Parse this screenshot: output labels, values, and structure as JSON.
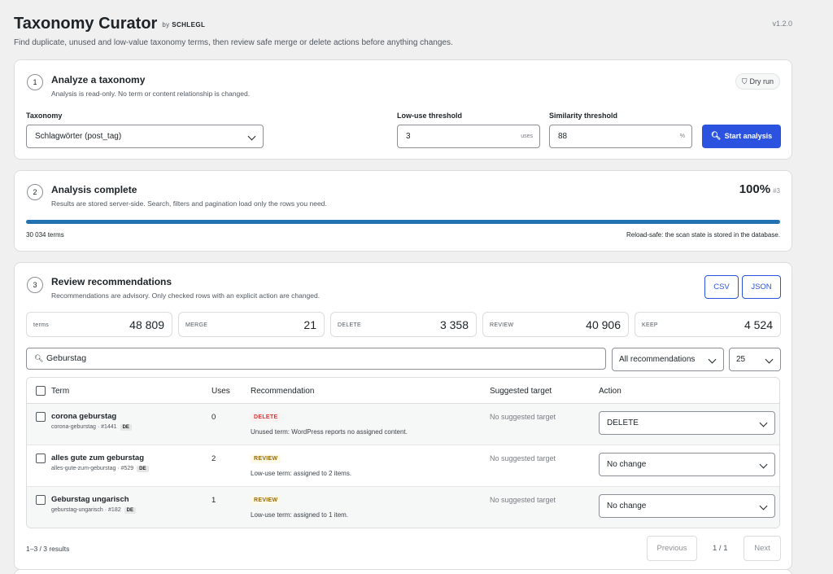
{
  "header": {
    "title": "Taxonomy Curator",
    "by_prefix": "by",
    "by_author": "SCHLEGL",
    "version": "v1.2.0",
    "subtitle": "Find duplicate, unused and low-value taxonomy terms, then review safe merge or delete actions before anything changes."
  },
  "step1": {
    "number": "1",
    "title": "Analyze a taxonomy",
    "desc": "Analysis is read-only. No term or content relationship is changed.",
    "dry_run_label": "Dry run",
    "taxonomy_label": "Taxonomy",
    "taxonomy_value": "Schlagwörter (post_tag)",
    "low_use_label": "Low-use threshold",
    "low_use_value": "3",
    "low_use_unit": "uses",
    "similarity_label": "Similarity threshold",
    "similarity_value": "88",
    "similarity_unit": "%",
    "start_label": "Start analysis"
  },
  "step2": {
    "number": "2",
    "title": "Analysis complete",
    "desc": "Results are stored server-side. Search, filters and pagination load only the rows you need.",
    "percent": "100%",
    "job": "#3",
    "progress": 1.0,
    "terms_count": "30 034 terms",
    "reload_note": "Reload-safe: the scan state is stored in the database."
  },
  "step3": {
    "number": "3",
    "title": "Review recommendations",
    "desc": "Recommendations are advisory. Only checked rows with an explicit action are changed.",
    "csv_label": "CSV",
    "json_label": "JSON",
    "stats": [
      {
        "label": "terms",
        "value": "48 809"
      },
      {
        "label": "MERGE",
        "value": "21"
      },
      {
        "label": "DELETE",
        "value": "3 358"
      },
      {
        "label": "REVIEW",
        "value": "40 906"
      },
      {
        "label": "KEEP",
        "value": "4 524"
      }
    ],
    "search_value": "Geburstag",
    "filter_value": "All recommendations",
    "per_page": "25",
    "columns": {
      "term": "Term",
      "uses": "Uses",
      "recommendation": "Recommendation",
      "target": "Suggested target",
      "action": "Action"
    },
    "rows": [
      {
        "name": "corona geburstag",
        "meta": "corona-geburstag · #1441",
        "lang": "DE",
        "uses": "0",
        "badge": "DELETE",
        "reason": "Unused term: WordPress reports no assigned content.",
        "target": "No suggested target",
        "action": "DELETE"
      },
      {
        "name": "alles gute zum geburstag",
        "meta": "alles-gute-zum-geburstag · #529",
        "lang": "DE",
        "uses": "2",
        "badge": "REVIEW",
        "reason": "Low-use term: assigned to 2 items.",
        "target": "No suggested target",
        "action": "No change"
      },
      {
        "name": "Geburstag ungarisch",
        "meta": "geburstag-ungarisch · #182",
        "lang": "DE",
        "uses": "1",
        "badge": "REVIEW",
        "reason": "Low-use term: assigned to 1 item.",
        "target": "No suggested target",
        "action": "No change"
      }
    ],
    "results_text": "1–3 / 3 results",
    "prev_label": "Previous",
    "page_info": "1 / 1",
    "next_label": "Next"
  }
}
